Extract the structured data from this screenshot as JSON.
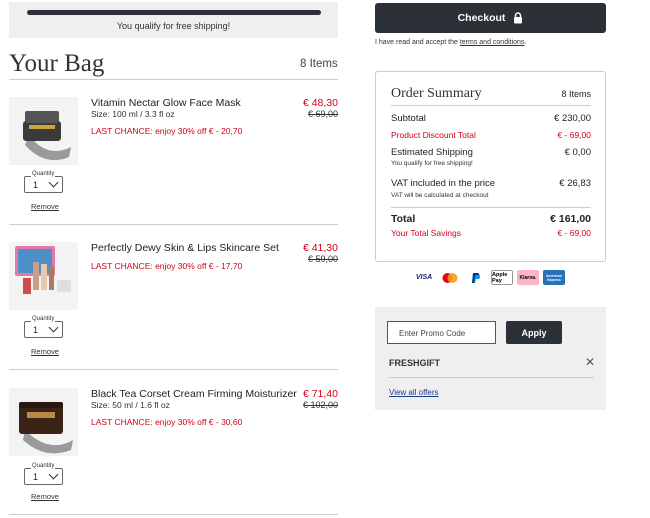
{
  "shipping_banner": {
    "text": "You qualify for free shipping!"
  },
  "bag": {
    "title": "Your Bag",
    "count": "8 Items"
  },
  "items": [
    {
      "name": "Vitamin Nectar Glow Face Mask",
      "size": "Size: 100 ml / 3.3 fl oz",
      "promo": "LAST CHANCE: enjoy 30% off € - 20,70",
      "price": "€ 48,30",
      "old_price": "€ 69,00",
      "qty_label": "Quantity",
      "qty": "1",
      "remove": "Remove"
    },
    {
      "name": "Perfectly Dewy Skin & Lips Skincare Set",
      "size": "",
      "promo": "LAST CHANCE: enjoy 30% off € - 17,70",
      "price": "€ 41,30",
      "old_price": "€ 59,00",
      "qty_label": "Quantity",
      "qty": "1",
      "remove": "Remove"
    },
    {
      "name": "Black Tea Corset Cream Firming Moisturizer",
      "size": "Size: 50 ml / 1.6 fl oz",
      "promo": "LAST CHANCE: enjoy 30% off € - 30,60",
      "price": "€ 71,40",
      "old_price": "€ 102,00",
      "qty_label": "Quantity",
      "qty": "1",
      "remove": "Remove"
    }
  ],
  "checkout": {
    "label": "Checkout",
    "terms_prefix": "I have read and accept the ",
    "terms_link": "terms and conditions",
    "terms_suffix": "."
  },
  "summary": {
    "title": "Order Summary",
    "count": "8 Items",
    "subtotal_label": "Subtotal",
    "subtotal": "€ 230,00",
    "discount_label": "Product Discount Total",
    "discount": "€ - 69,00",
    "shipping_label": "Estimated Shipping",
    "shipping": "€ 0,00",
    "shipping_note": "You qualify for free shipping!",
    "vat_label": "VAT included in the price",
    "vat": "€ 26,83",
    "vat_note": "VAT will be calculated at checkout",
    "total_label": "Total",
    "total": "€ 161,00",
    "savings_label": "Your Total Savings",
    "savings": "€ - 69,00"
  },
  "payment_methods": [
    "VISA",
    "Mastercard",
    "PayPal",
    "Apple Pay",
    "Klarna.",
    "American Express"
  ],
  "promo": {
    "placeholder": "Enter Promo Code",
    "apply": "Apply",
    "code": "FRESHGIFT",
    "view_all": "View all offers"
  }
}
